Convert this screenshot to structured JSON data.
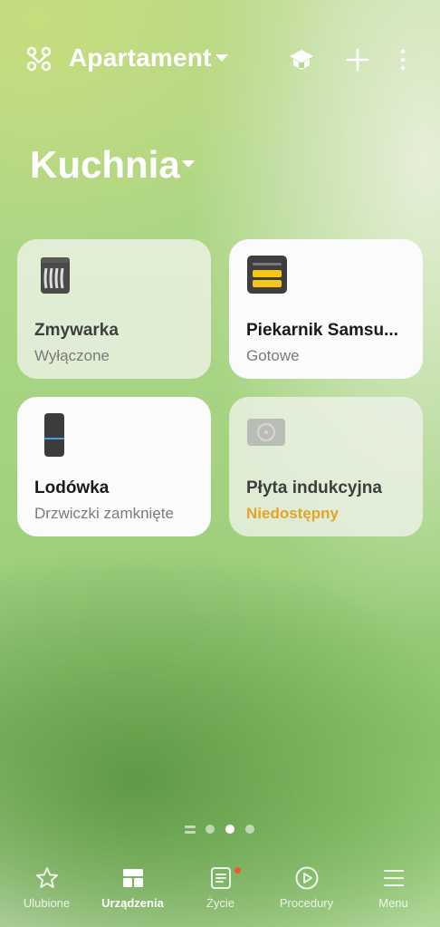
{
  "header": {
    "home_name": "Apartament",
    "icons": [
      "home-grid-icon",
      "hub-icon",
      "add-icon",
      "more-icon"
    ]
  },
  "room": {
    "name": "Kuchnia"
  },
  "devices": [
    {
      "name": "Zmywarka",
      "status": "Wyłączone",
      "state": "off",
      "icon": "dishwasher-icon"
    },
    {
      "name": "Piekarnik Samsu...",
      "status": "Gotowe",
      "state": "on",
      "icon": "oven-icon"
    },
    {
      "name": "Lodówka",
      "status": "Drzwiczki zamknięte",
      "state": "on",
      "icon": "fridge-icon"
    },
    {
      "name": "Płyta indukcyjna",
      "status": "Niedostępny",
      "state": "unavailable",
      "icon": "cooktop-icon"
    }
  ],
  "pager": {
    "pages": 4,
    "current": 3
  },
  "nav": {
    "items": [
      {
        "label": "Ulubione",
        "icon": "star-icon",
        "active": false
      },
      {
        "label": "Urządzenia",
        "icon": "devices-icon",
        "active": true
      },
      {
        "label": "Życie",
        "icon": "life-icon",
        "active": false,
        "badge": true
      },
      {
        "label": "Procedury",
        "icon": "play-icon",
        "active": false
      },
      {
        "label": "Menu",
        "icon": "menu-icon",
        "active": false
      }
    ]
  },
  "colors": {
    "warning": "#e5a327",
    "badge": "#ee5a2b",
    "oven_accent": "#f5c518"
  }
}
